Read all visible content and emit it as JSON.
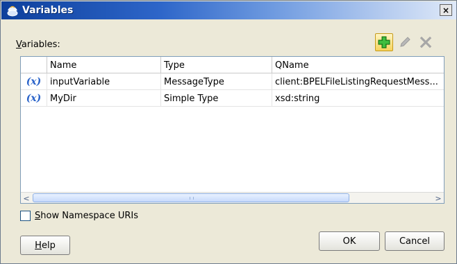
{
  "window": {
    "title": "Variables",
    "close_label": "×"
  },
  "variables_label_first": "V",
  "variables_label_rest": "ariables:",
  "toolbar": {
    "add_icon": "add-plus-icon",
    "edit_icon": "pencil-icon",
    "delete_icon": "delete-x-icon"
  },
  "table": {
    "columns": [
      "",
      "Name",
      "Type",
      "QName"
    ],
    "rows": [
      {
        "icon": "(x)",
        "name": "inputVariable",
        "type": "MessageType",
        "qname": "client:BPELFileListingRequestMess..."
      },
      {
        "icon": "(x)",
        "name": "MyDir",
        "type": "Simple Type",
        "qname": "xsd:string"
      }
    ]
  },
  "show_ns": {
    "first": "S",
    "rest": "how Namespace URIs",
    "checked": false
  },
  "buttons": {
    "help_first": "H",
    "help_rest": "elp",
    "ok": "OK",
    "cancel": "Cancel"
  },
  "colors": {
    "titlebar_start": "#0d3f9c",
    "titlebar_end": "#dfe9f8",
    "var_icon": "#2a63c9",
    "add_icon": "#2da32d"
  }
}
